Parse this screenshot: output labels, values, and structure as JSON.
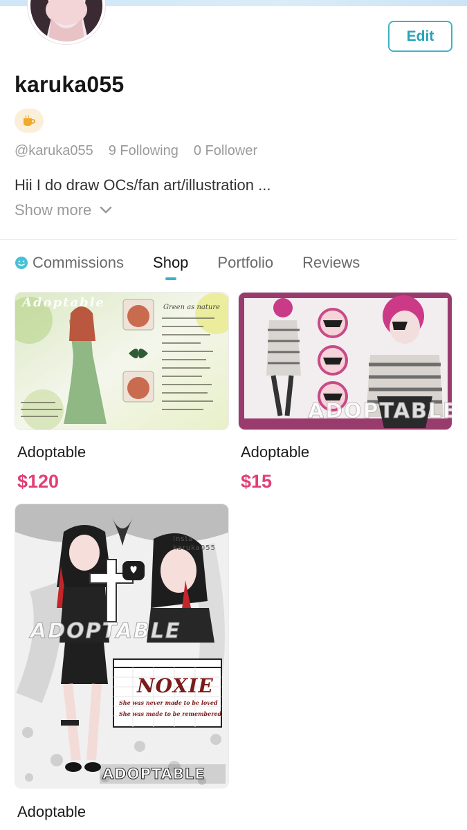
{
  "profile": {
    "username": "karuka055",
    "handle": "@karuka055",
    "following": "9 Following",
    "followers": "0 Follower",
    "bio": "Hii I do draw OCs/fan art/illustration ...",
    "show_more": "Show more",
    "edit_label": "Edit",
    "badge_icon": "coffee-cup-icon"
  },
  "tabs": [
    {
      "label": "Commissions",
      "active": false
    },
    {
      "label": "Shop",
      "active": true
    },
    {
      "label": "Portfolio",
      "active": false
    },
    {
      "label": "Reviews",
      "active": false
    }
  ],
  "products": [
    {
      "title": "Adoptable",
      "price": "$120"
    },
    {
      "title": "Adoptable",
      "price": "$15"
    },
    {
      "title": "Adoptable",
      "price": ""
    }
  ],
  "artwork_text": {
    "card1_heading": "Adoptable",
    "card1_subheading": "Green as nature",
    "card2_watermark": "ADOPTABLE",
    "card3_watermark": "ADOPTABLE",
    "card3_banner": "ADOPTABLE",
    "card3_name": "NOXIE",
    "card3_line1": "She was never made to be loved",
    "card3_line2": "She was made to be remembered",
    "card3_insta": "Insta karuka055"
  },
  "colors": {
    "accent": "#3bb3c4",
    "price": "#e23d77"
  }
}
